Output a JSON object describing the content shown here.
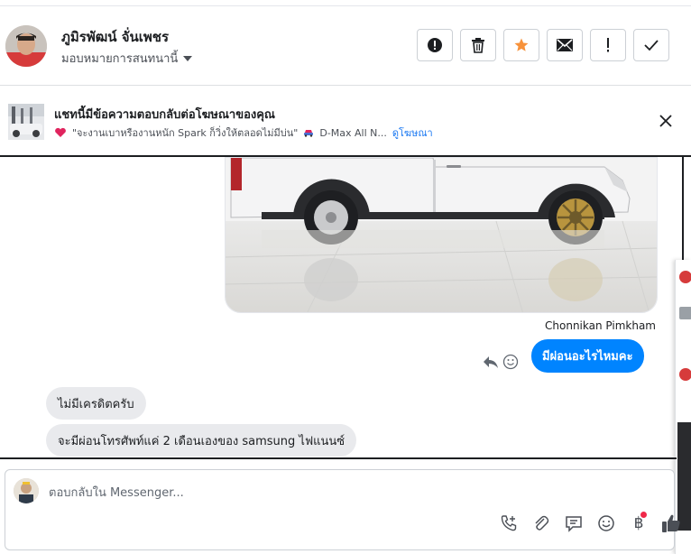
{
  "header": {
    "contact_name": "ภูมิรพัฒน์ จั่นเพชร",
    "assign_label": "มอบหมายการสนทนานี้",
    "actions": [
      {
        "name": "report-button",
        "icon": "alert-circle-icon"
      },
      {
        "name": "delete-button",
        "icon": "trash-icon"
      },
      {
        "name": "star-button",
        "icon": "star-icon"
      },
      {
        "name": "mark-unread-button",
        "icon": "envelope-icon"
      },
      {
        "name": "follow-up-button",
        "icon": "exclamation-icon"
      },
      {
        "name": "mark-done-button",
        "icon": "check-icon"
      }
    ]
  },
  "ad_bar": {
    "title": "แชทนี้มีข้อความตอบกลับต่อโฆษณาของคุณ",
    "ad_text": "\"จะงานเบาหรืองานหนัก Spark ก็วิ่งให้ตลอดไม่มีบ่น\"",
    "ad_product": "D-Max All N...",
    "view_ad_link": "ดูโฆษณา"
  },
  "conversation": {
    "sender_name": "Chonnikan Pimkham",
    "outgoing_message": "มีผ่อนอะไรไหมคะ",
    "incoming_messages": [
      "ไม่มีเครดิตครับ",
      "จะมีผ่อนโทรศัพท์แค่ 2 เดือนเองของ samsung ไฟแนนซ์"
    ]
  },
  "composer": {
    "placeholder": "ตอบกลับใน Messenger...",
    "tools": [
      "call-add-icon",
      "paperclip-icon",
      "saved-reply-icon",
      "emoji-icon",
      "baht-payment-icon",
      "thumbs-up-icon"
    ],
    "baht_symbol": "฿"
  },
  "colors": {
    "brand_blue": "#0084ff",
    "star_orange": "#f7923b",
    "link_blue": "#1877f2",
    "incoming_bubble": "#e9eaed"
  }
}
